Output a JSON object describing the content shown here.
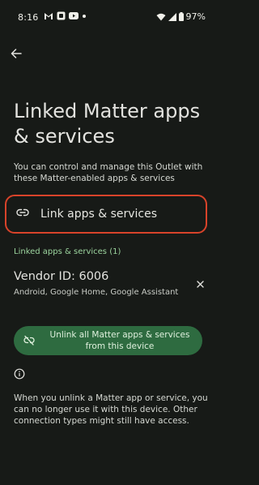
{
  "status_bar": {
    "time": "8:16",
    "battery": "97%",
    "left_icons": [
      "gmail-icon",
      "app-icon",
      "youtube-icon",
      "dot-icon"
    ],
    "right_icons": [
      "wifi-icon",
      "cellular-icon",
      "battery-icon"
    ]
  },
  "page": {
    "title_line1": "Linked Matter apps",
    "title_line2": "& services",
    "description": "You can control and manage this Outlet with these Matter-enabled apps & services"
  },
  "link_action": {
    "label": "Link apps & services",
    "icon": "link-icon"
  },
  "linked_section": {
    "header": "Linked apps & services (1)",
    "items": [
      {
        "title": "Vendor ID: 6006",
        "subtitle": "Android, Google Home, Google Assistant"
      }
    ]
  },
  "unlink_button": {
    "line1": "Unlink all Matter apps & services",
    "line2": "from this device",
    "icon": "link-off-icon"
  },
  "footer": {
    "text": "When you unlink a Matter app or service, you can no longer use it with this device. Other connection types might still have access."
  },
  "colors": {
    "background": "#171a17",
    "accent_green": "#9cd49e",
    "button_bg": "#2e6b40",
    "highlight_red": "#d8432a"
  }
}
